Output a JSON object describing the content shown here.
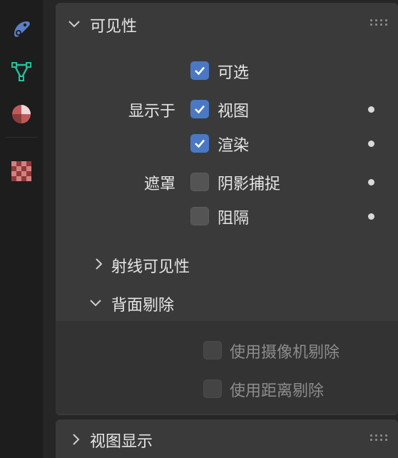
{
  "sidebar": {
    "icons": [
      "constraint-icon",
      "mesh-data-icon",
      "material-icon",
      "texture-icon"
    ]
  },
  "visibility_panel": {
    "title": "可见性",
    "selectable": {
      "label": "可选",
      "checked": true
    },
    "show_in": {
      "label": "显示于",
      "viewport": {
        "label": "视图",
        "checked": true
      },
      "render": {
        "label": "渲染",
        "checked": true
      }
    },
    "mask": {
      "label": "遮罩",
      "shadow_catcher": {
        "label": "阴影捕捉",
        "checked": false
      },
      "holdout": {
        "label": "阻隔",
        "checked": false
      }
    },
    "ray_visibility": {
      "label": "射线可见性",
      "expanded": false
    },
    "culling": {
      "label": "背面剔除",
      "expanded": true,
      "use_camera_cull": {
        "label": "使用摄像机剔除",
        "checked": false,
        "enabled": false
      },
      "use_distance_cull": {
        "label": "使用距离剔除",
        "checked": false,
        "enabled": false
      }
    }
  },
  "viewport_display_panel": {
    "title": "视图显示",
    "expanded": false
  },
  "colors": {
    "accent": "#4a78c4",
    "panel_bg": "#3a3a3a",
    "sidebar_bg": "#1d1d1d"
  }
}
